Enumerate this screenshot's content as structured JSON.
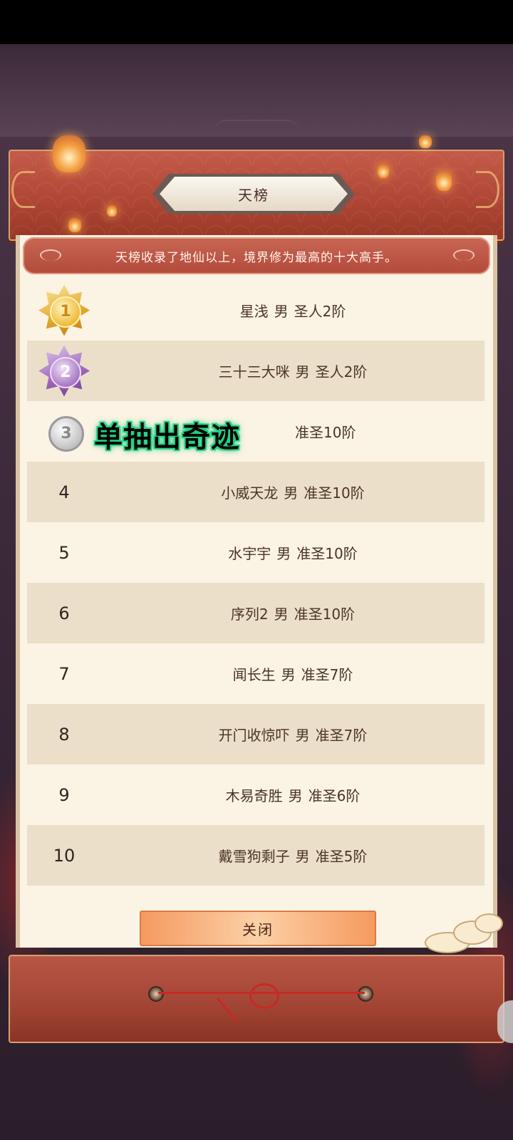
{
  "header": {
    "title": "天榜"
  },
  "description": "天榜收录了地仙以上，境界修为最高的十大高手。",
  "ranking": [
    {
      "rank": "1",
      "medal": "gold",
      "name": "星浅",
      "gender": "男",
      "realm": "圣人2阶"
    },
    {
      "rank": "2",
      "medal": "purple",
      "name": "三十三大咪",
      "gender": "男",
      "realm": "圣人2阶"
    },
    {
      "rank": "3",
      "medal": "silver",
      "name": "",
      "gender": "",
      "realm": "准圣10阶"
    },
    {
      "rank": "4",
      "medal": "",
      "name": "小威天龙",
      "gender": "男",
      "realm": "准圣10阶"
    },
    {
      "rank": "5",
      "medal": "",
      "name": "水宇宇",
      "gender": "男",
      "realm": "准圣10阶"
    },
    {
      "rank": "6",
      "medal": "",
      "name": "序列2",
      "gender": "男",
      "realm": "准圣10阶"
    },
    {
      "rank": "7",
      "medal": "",
      "name": "闻长生",
      "gender": "男",
      "realm": "准圣7阶"
    },
    {
      "rank": "8",
      "medal": "",
      "name": "开门收惊吓",
      "gender": "男",
      "realm": "准圣7阶"
    },
    {
      "rank": "9",
      "medal": "",
      "name": "木易奇胜",
      "gender": "男",
      "realm": "准圣6阶"
    },
    {
      "rank": "10",
      "medal": "",
      "name": "戴雪狗剩子",
      "gender": "男",
      "realm": "准圣5阶"
    }
  ],
  "overlay": {
    "text": "单抽出奇迹",
    "color": "#2fe08f"
  },
  "close_label": "关闭",
  "colors": {
    "accent_red": "#b24a3a",
    "paper": "#fbf3e3",
    "row_alt": "#ebdfc9",
    "text_brown": "#4b3428"
  }
}
